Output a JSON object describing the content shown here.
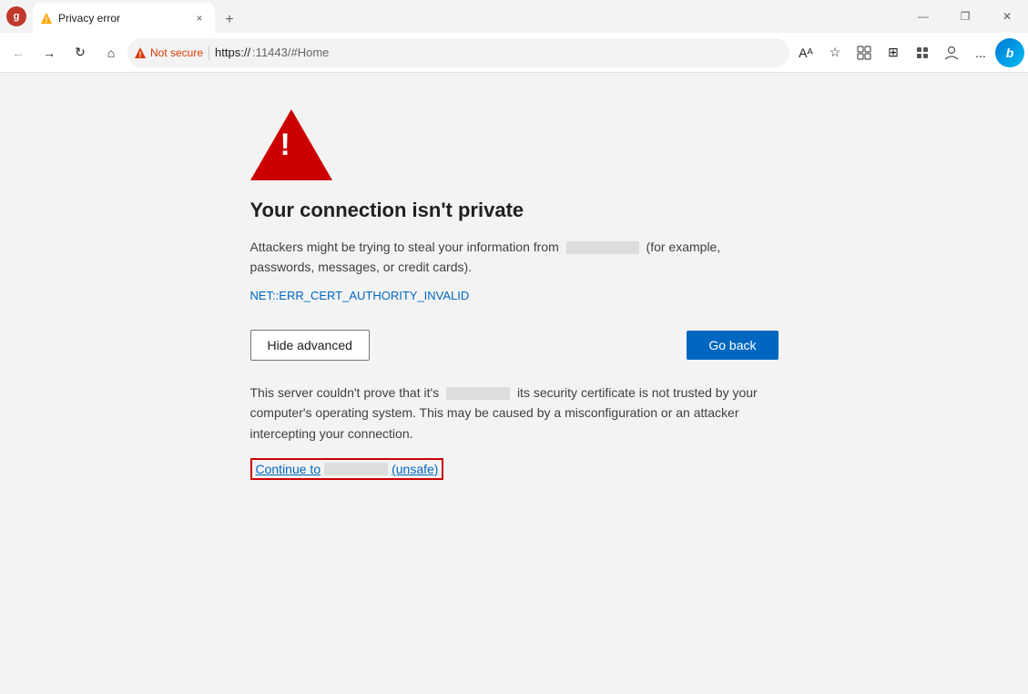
{
  "titlebar": {
    "tab_title": "Privacy error",
    "tab_close_label": "×",
    "new_tab_label": "+",
    "win_minimize": "—",
    "win_restore": "❐",
    "win_close": "✕"
  },
  "navbar": {
    "back_label": "←",
    "forward_label": "→",
    "refresh_label": "↻",
    "home_label": "⌂",
    "security_label": "Not secure",
    "address_https": "https://",
    "address_path": ":11443/#Home",
    "read_aloud_label": "Aᴬ",
    "favorites_label": "☆",
    "extensions_label": "🧩",
    "split_label": "⊞",
    "collections_label": "≡",
    "copilot_label": "👤",
    "more_label": "...",
    "bing_label": "b"
  },
  "error": {
    "title": "Your connection isn't private",
    "description_part1": "Attackers might be trying to steal your information from",
    "description_redacted": "                   ",
    "description_part2": "(for example, passwords, messages, or credit cards).",
    "error_code": "NET::ERR_CERT_AUTHORITY_INVALID",
    "hide_advanced_label": "Hide advanced",
    "go_back_label": "Go back",
    "advanced_text_part1": "This server couldn't prove that it's",
    "advanced_redacted": "              ",
    "advanced_text_part2": "its security certificate is not trusted by your computer's operating system. This may be caused by a misconfiguration or an attacker intercepting your connection.",
    "continue_label": "Continue to",
    "continue_redacted": "              ",
    "continue_unsafe": "(unsafe)"
  }
}
